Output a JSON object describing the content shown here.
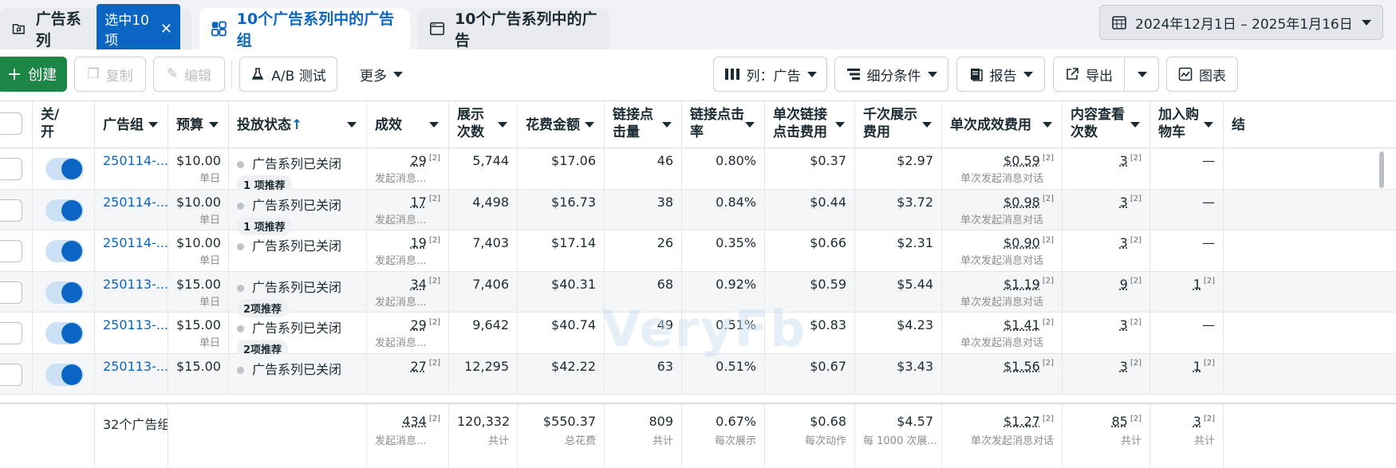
{
  "tabs": {
    "campaigns": {
      "label": "广告系列",
      "selected_chip": "选中10项"
    },
    "adsets": {
      "label": "10个广告系列中的广告组"
    },
    "ads": {
      "label": "10个广告系列中的广告"
    }
  },
  "date_range": "2024年12月1日 – 2025年1月16日",
  "toolbar": {
    "create": "创建",
    "duplicate": "复制",
    "edit": "编辑",
    "ab_test": "A/B 测试",
    "more": "更多",
    "columns": "列：广告",
    "breakdown": "细分条件",
    "reports": "报告",
    "export": "导出",
    "charts": "图表"
  },
  "columns": [
    "关/\n开",
    "广告组",
    "预算",
    "投放状态",
    "成效",
    "展示\n次数",
    "花费金额",
    "链接点\n击量",
    "链接点击\n率",
    "单次链接\n点击费用",
    "千次展示\n费用",
    "单次成效费用",
    "内容查看\n次数",
    "加入购\n物车",
    "结"
  ],
  "sort_arrow": "↑",
  "note_mark": "[2]",
  "rows": [
    {
      "name": "250114-...",
      "budget": "$10.00",
      "budget_type": "单日",
      "status": "广告系列已关闭",
      "recommend": "1 项推荐",
      "results": "29",
      "results_type": "发起消息...",
      "impressions": "5,744",
      "spend": "$17.06",
      "clicks": "46",
      "ctr": "0.80%",
      "cpc": "$0.37",
      "cpm": "$2.97",
      "cpr": "$0.59",
      "cpr_type": "单次发起消息对话",
      "views": "3",
      "cart": "—"
    },
    {
      "name": "250114-...",
      "budget": "$10.00",
      "budget_type": "单日",
      "status": "广告系列已关闭",
      "recommend": "1 项推荐",
      "results": "17",
      "results_type": "发起消息...",
      "impressions": "4,498",
      "spend": "$16.73",
      "clicks": "38",
      "ctr": "0.84%",
      "cpc": "$0.44",
      "cpm": "$3.72",
      "cpr": "$0.98",
      "cpr_type": "单次发起消息对话",
      "views": "3",
      "cart": "—"
    },
    {
      "name": "250114-...",
      "budget": "$10.00",
      "budget_type": "单日",
      "status": "广告系列已关闭",
      "recommend": "",
      "results": "19",
      "results_type": "发起消息...",
      "impressions": "7,403",
      "spend": "$17.14",
      "clicks": "26",
      "ctr": "0.35%",
      "cpc": "$0.66",
      "cpm": "$2.31",
      "cpr": "$0.90",
      "cpr_type": "单次发起消息对话",
      "views": "3",
      "cart": "—"
    },
    {
      "name": "250113-...",
      "budget": "$15.00",
      "budget_type": "单日",
      "status": "广告系列已关闭",
      "recommend": "2项推荐",
      "results": "34",
      "results_type": "发起消息...",
      "impressions": "7,406",
      "spend": "$40.31",
      "clicks": "68",
      "ctr": "0.92%",
      "cpc": "$0.59",
      "cpm": "$5.44",
      "cpr": "$1.19",
      "cpr_type": "单次发起消息对话",
      "views": "9",
      "cart": "1"
    },
    {
      "name": "250113-...",
      "budget": "$15.00",
      "budget_type": "单日",
      "status": "广告系列已关闭",
      "recommend": "2项推荐",
      "results": "29",
      "results_type": "发起消息...",
      "impressions": "9,642",
      "spend": "$40.74",
      "clicks": "49",
      "ctr": "0.51%",
      "cpc": "$0.83",
      "cpm": "$4.23",
      "cpr": "$1.41",
      "cpr_type": "单次发起消息对话",
      "views": "3",
      "cart": "—"
    },
    {
      "name": "250113-...",
      "budget": "$15.00",
      "budget_type": "",
      "status": "广告系列已关闭",
      "recommend": "",
      "results": "27",
      "results_type": "",
      "impressions": "12,295",
      "spend": "$42.22",
      "clicks": "63",
      "ctr": "0.51%",
      "cpc": "$0.67",
      "cpm": "$3.43",
      "cpr": "$1.56",
      "cpr_type": "",
      "views": "3",
      "cart": "1"
    }
  ],
  "footer": {
    "count": "32个广告组",
    "results": "434",
    "results_type": "发起消息...",
    "impressions": "120,332",
    "impressions_note": "共计",
    "spend": "$550.37",
    "spend_note": "总花费",
    "clicks": "809",
    "clicks_note": "共计",
    "ctr": "0.67%",
    "ctr_note": "每次展示",
    "cpc": "$0.68",
    "cpc_note": "每次动作",
    "cpm": "$4.57",
    "cpm_note": "每 1000 次展...",
    "cpr": "$1.27",
    "cpr_note": "单次发起消息对话",
    "views": "85",
    "views_note": "共计",
    "cart": "3",
    "cart_note": "共计"
  },
  "watermark": "VeryFb",
  "colors": {
    "accent": "#0a66c2",
    "create_green": "#1b8645"
  },
  "icons": {
    "campaign": "folder-flag-icon",
    "adset": "grid-icon",
    "ad": "window-icon",
    "calendar": "calendar-icon"
  }
}
